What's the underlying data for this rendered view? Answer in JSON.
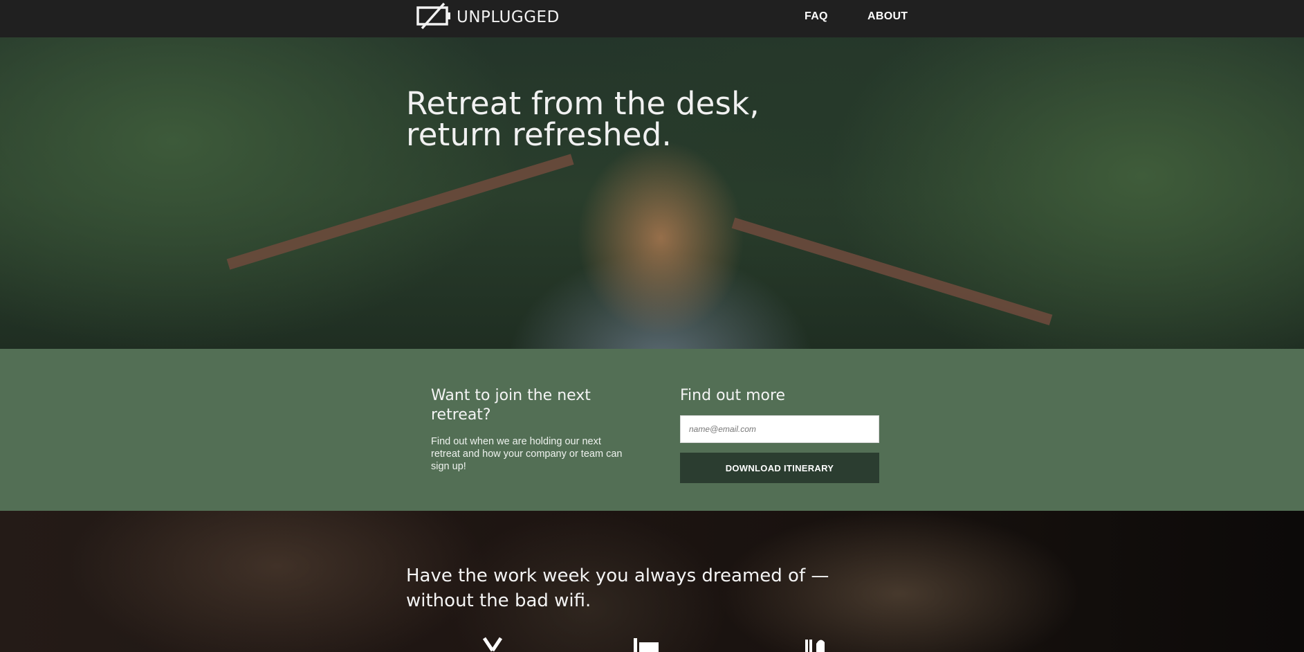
{
  "nav": {
    "logo_text": "UNPLUGGED",
    "logo_icon": "battery-slash-icon",
    "links": [
      {
        "label": "FAQ"
      },
      {
        "label": "ABOUT"
      }
    ]
  },
  "hero": {
    "title_line1": "Retreat from the desk,",
    "title_line2": "return refreshed."
  },
  "signup": {
    "left_heading": "Want to join the next retreat?",
    "left_text": "Find out when we are holding our next retreat and how your company or team can sign up!",
    "right_heading": "Find out more",
    "email_placeholder": "name@email.com",
    "button_label": "DOWNLOAD ITINERARY"
  },
  "lower": {
    "title": "Have the work week you always dreamed of — without the bad wifi.",
    "icons": [
      "campfire-icon",
      "bed-icon",
      "food-icon"
    ]
  },
  "colors": {
    "nav_bg": "#202020",
    "signup_bg": "#536f55",
    "button_bg": "#2b3d30"
  }
}
